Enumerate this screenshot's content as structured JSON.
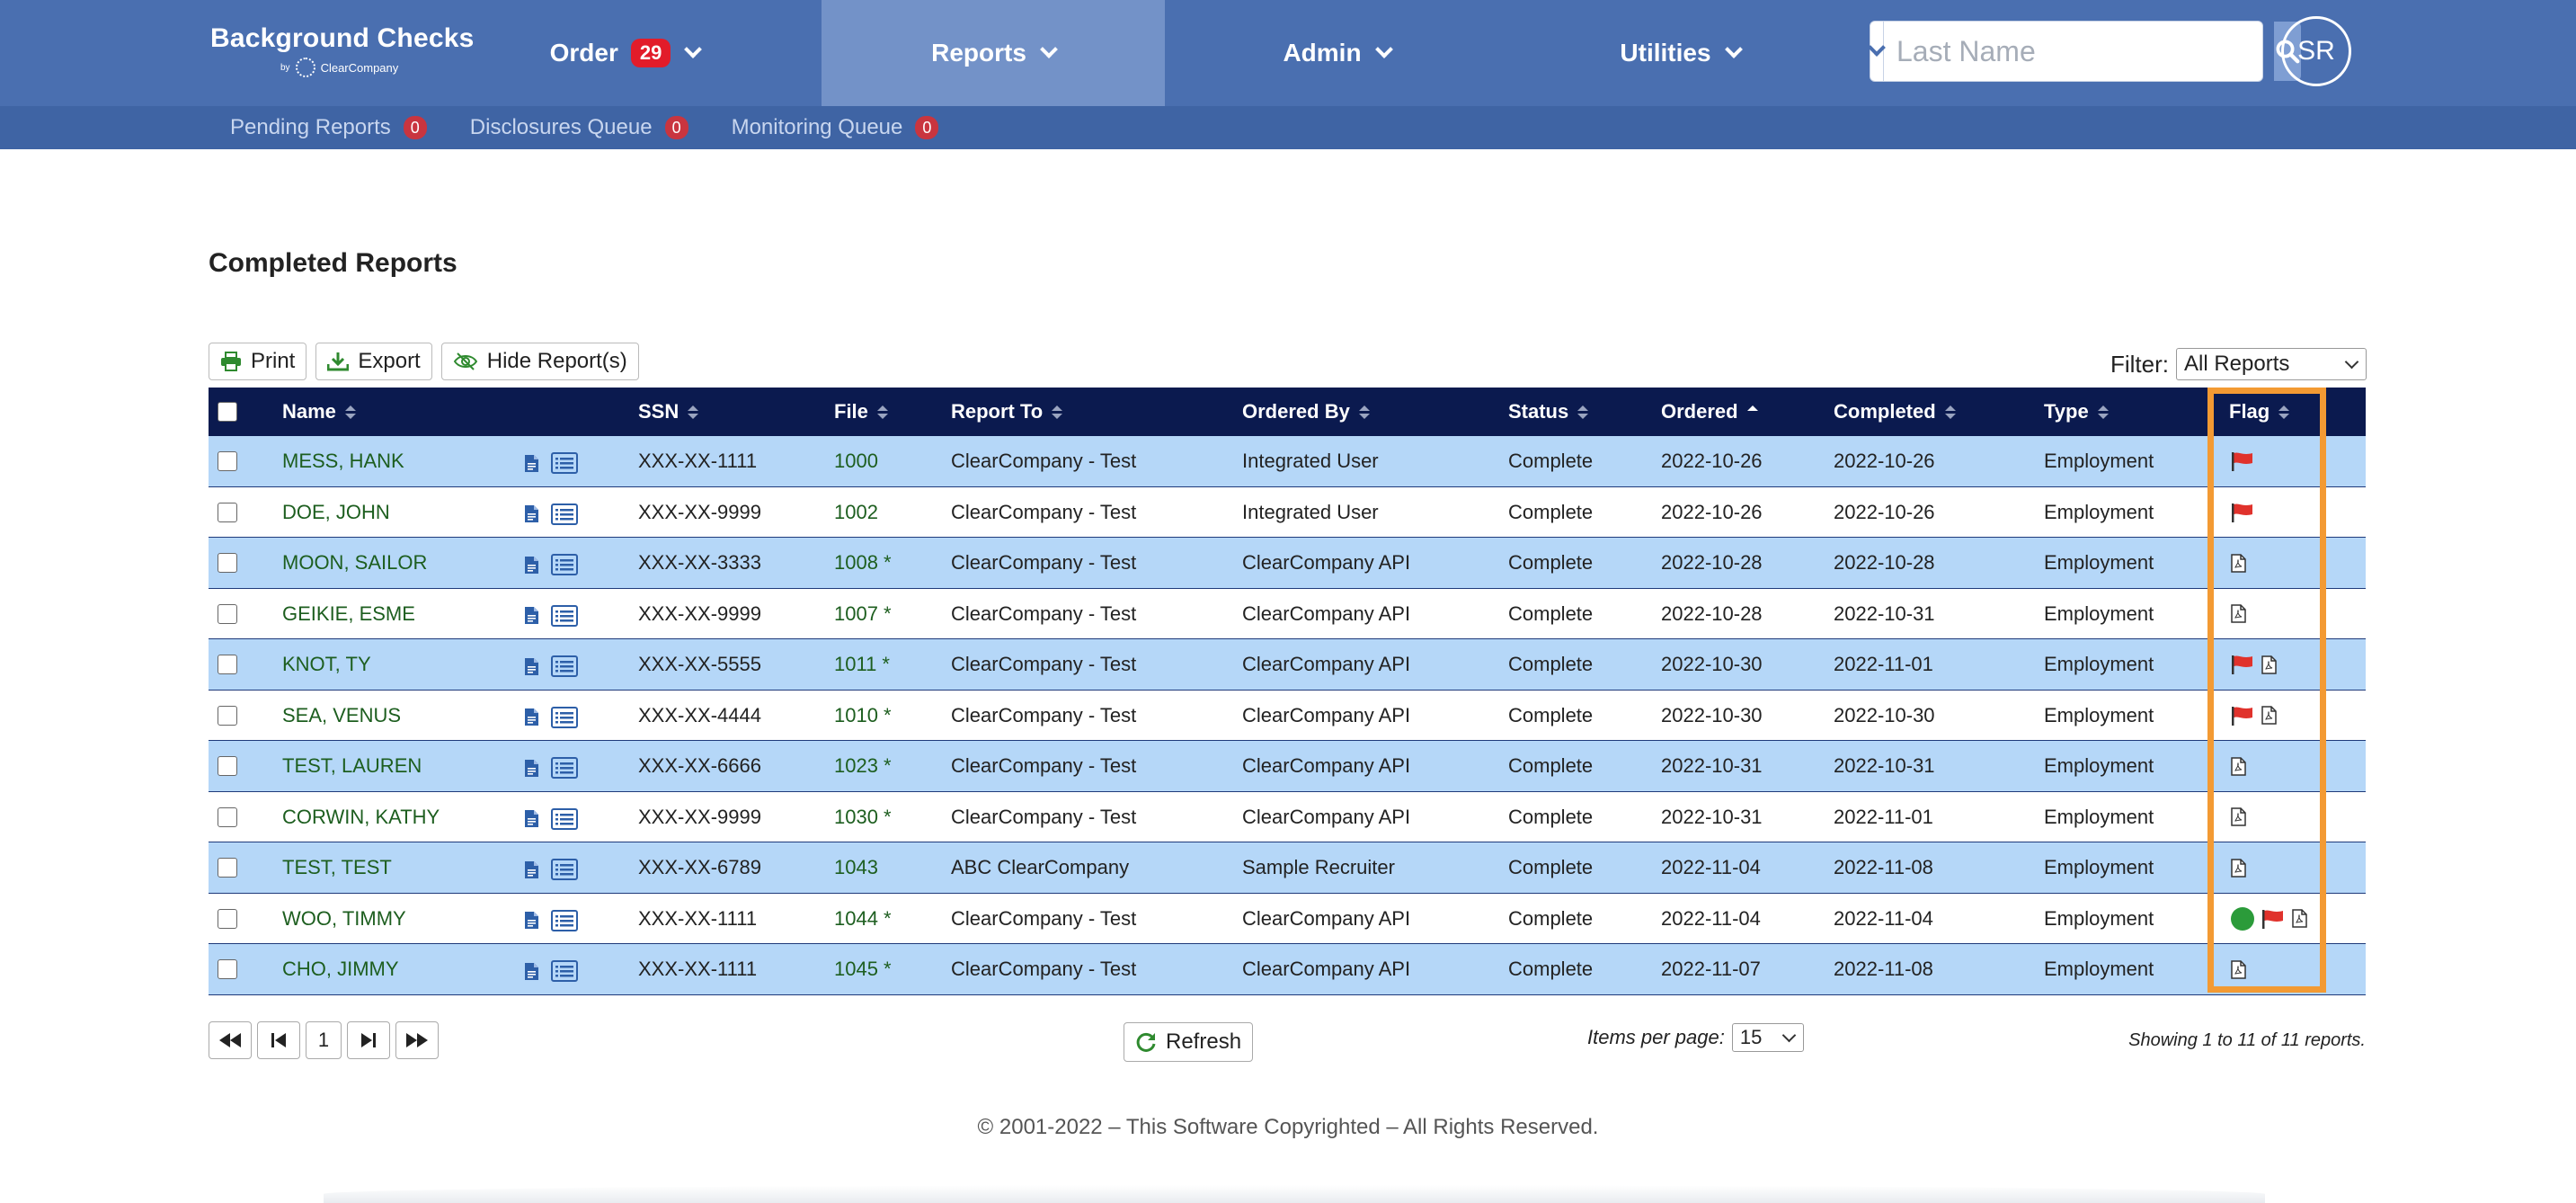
{
  "brand": {
    "title": "Background Checks",
    "by": "by",
    "company": "ClearCompany"
  },
  "nav": {
    "order_label": "Order",
    "order_badge": "29",
    "reports_label": "Reports",
    "admin_label": "Admin",
    "utilities_label": "Utilities"
  },
  "search": {
    "placeholder": "Last Name",
    "value": ""
  },
  "user": {
    "initials": "SR"
  },
  "subnav": {
    "items": [
      {
        "label": "Pending Reports",
        "count": "0"
      },
      {
        "label": "Disclosures Queue",
        "count": "0"
      },
      {
        "label": "Monitoring Queue",
        "count": "0"
      }
    ]
  },
  "page": {
    "title": "Completed Reports"
  },
  "toolbar": {
    "print_label": "Print",
    "export_label": "Export",
    "hide_label": "Hide Report(s)"
  },
  "filter": {
    "label": "Filter:",
    "selected": "All Reports"
  },
  "table": {
    "columns": {
      "name": "Name",
      "ssn": "SSN",
      "file": "File",
      "report_to": "Report To",
      "ordered_by": "Ordered By",
      "status": "Status",
      "ordered": "Ordered",
      "completed": "Completed",
      "type": "Type",
      "flag": "Flag"
    },
    "sorted_column": "ordered",
    "rows": [
      {
        "name": "MESS, HANK",
        "ssn": "XXX-XX-1111",
        "file": "1000",
        "report_to": "ClearCompany - Test",
        "ordered_by": "Integrated User",
        "status": "Complete",
        "ordered": "2022-10-26",
        "completed": "2022-10-26",
        "type": "Employment",
        "flags": [
          "flag-icon"
        ]
      },
      {
        "name": "DOE, JOHN",
        "ssn": "XXX-XX-9999",
        "file": "1002",
        "report_to": "ClearCompany - Test",
        "ordered_by": "Integrated User",
        "status": "Complete",
        "ordered": "2022-10-26",
        "completed": "2022-10-26",
        "type": "Employment",
        "flags": [
          "flag-icon"
        ]
      },
      {
        "name": "MOON, SAILOR",
        "ssn": "XXX-XX-3333",
        "file": "1008 *",
        "report_to": "ClearCompany - Test",
        "ordered_by": "ClearCompany API",
        "status": "Complete",
        "ordered": "2022-10-28",
        "completed": "2022-10-28",
        "type": "Employment",
        "flags": [
          "pdf-icon"
        ]
      },
      {
        "name": "GEIKIE, ESME",
        "ssn": "XXX-XX-9999",
        "file": "1007 *",
        "report_to": "ClearCompany - Test",
        "ordered_by": "ClearCompany API",
        "status": "Complete",
        "ordered": "2022-10-28",
        "completed": "2022-10-31",
        "type": "Employment",
        "flags": [
          "pdf-icon"
        ]
      },
      {
        "name": "KNOT, TY",
        "ssn": "XXX-XX-5555",
        "file": "1011 *",
        "report_to": "ClearCompany - Test",
        "ordered_by": "ClearCompany API",
        "status": "Complete",
        "ordered": "2022-10-30",
        "completed": "2022-11-01",
        "type": "Employment",
        "flags": [
          "flag-icon",
          "pdf-icon"
        ]
      },
      {
        "name": "SEA, VENUS",
        "ssn": "XXX-XX-4444",
        "file": "1010 *",
        "report_to": "ClearCompany - Test",
        "ordered_by": "ClearCompany API",
        "status": "Complete",
        "ordered": "2022-10-30",
        "completed": "2022-10-30",
        "type": "Employment",
        "flags": [
          "flag-icon",
          "pdf-icon"
        ]
      },
      {
        "name": "TEST, LAUREN",
        "ssn": "XXX-XX-6666",
        "file": "1023 *",
        "report_to": "ClearCompany - Test",
        "ordered_by": "ClearCompany API",
        "status": "Complete",
        "ordered": "2022-10-31",
        "completed": "2022-10-31",
        "type": "Employment",
        "flags": [
          "pdf-icon"
        ]
      },
      {
        "name": "CORWIN, KATHY",
        "ssn": "XXX-XX-9999",
        "file": "1030 *",
        "report_to": "ClearCompany - Test",
        "ordered_by": "ClearCompany API",
        "status": "Complete",
        "ordered": "2022-10-31",
        "completed": "2022-11-01",
        "type": "Employment",
        "flags": [
          "pdf-icon"
        ]
      },
      {
        "name": "TEST, TEST",
        "ssn": "XXX-XX-6789",
        "file": "1043",
        "report_to": "ABC ClearCompany",
        "ordered_by": "Sample Recruiter",
        "status": "Complete",
        "ordered": "2022-11-04",
        "completed": "2022-11-08",
        "type": "Employment",
        "flags": [
          "pdf-icon"
        ]
      },
      {
        "name": "WOO, TIMMY",
        "ssn": "XXX-XX-1111",
        "file": "1044 *",
        "report_to": "ClearCompany - Test",
        "ordered_by": "ClearCompany API",
        "status": "Complete",
        "ordered": "2022-11-04",
        "completed": "2022-11-04",
        "type": "Employment",
        "flags": [
          "green-dot-icon",
          "flag-icon",
          "pdf-icon"
        ]
      },
      {
        "name": "CHO, JIMMY",
        "ssn": "XXX-XX-1111",
        "file": "1045 *",
        "report_to": "ClearCompany - Test",
        "ordered_by": "ClearCompany API",
        "status": "Complete",
        "ordered": "2022-11-07",
        "completed": "2022-11-08",
        "type": "Employment",
        "flags": [
          "pdf-icon"
        ]
      }
    ]
  },
  "pagination": {
    "current_page": "1",
    "refresh_label": "Refresh",
    "items_per_page_label": "Items per page:",
    "items_per_page": "15",
    "showing": "Showing 1 to 11 of 11 reports."
  },
  "footer": {
    "copyright": "© 2001-2022 – This Software Copyrighted – All Rights Reserved."
  },
  "colors": {
    "nav_bg": "#4a6fb0",
    "nav_active": "#7392c8",
    "subnav_bg": "#3f64a4",
    "table_header": "#0b1a4f",
    "row_highlight": "#b5d7f8",
    "link_green": "#1d5e1f",
    "flag_red": "#e0322c",
    "highlight_orange": "#f39a33",
    "badge_red": "#e21c2a"
  }
}
